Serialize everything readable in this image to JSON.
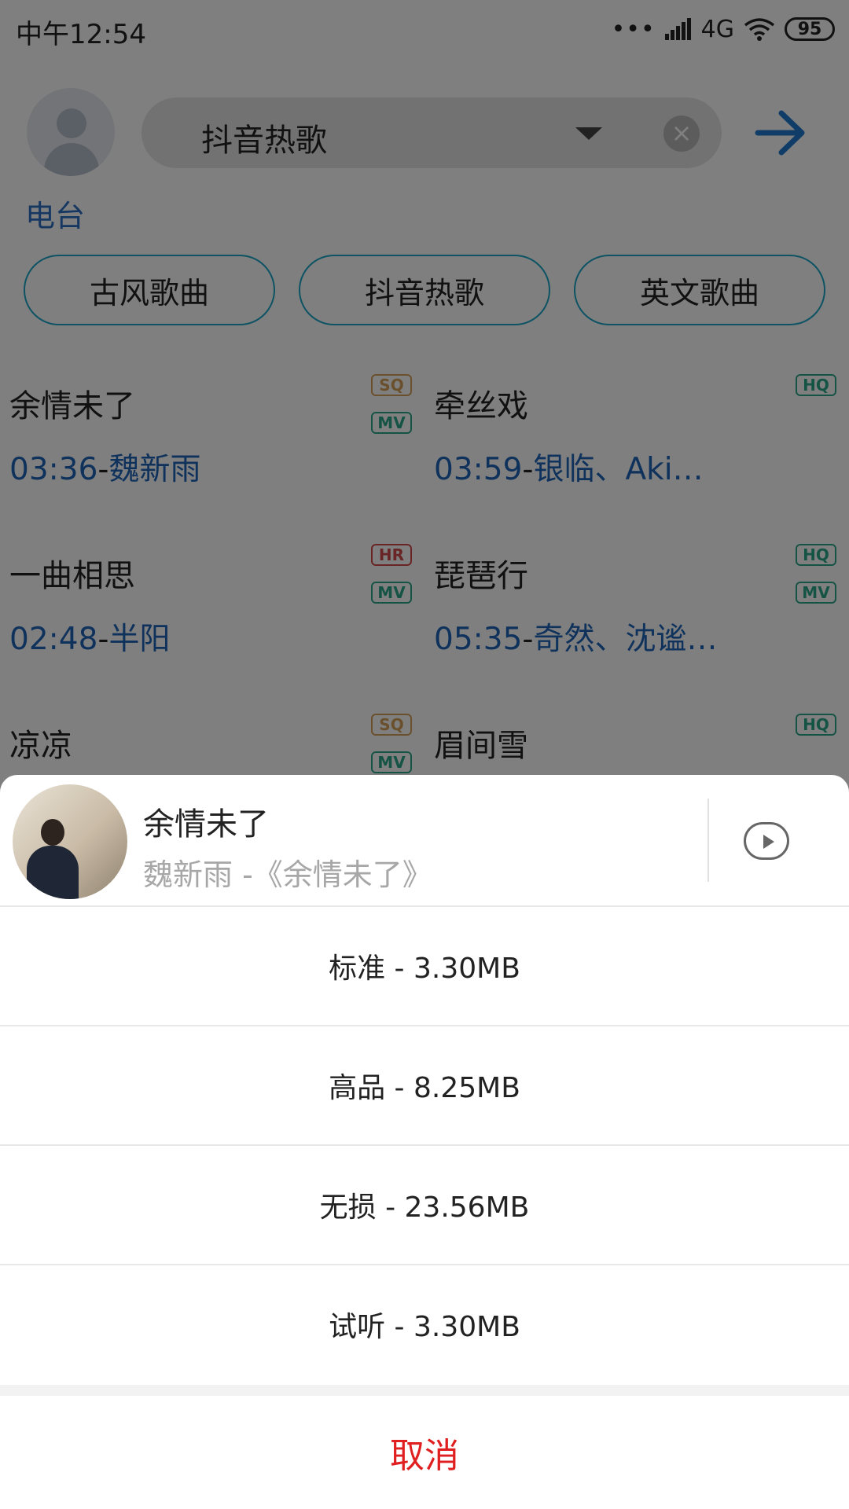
{
  "status_bar": {
    "time": "中午12:54",
    "dots": "•••",
    "network": "4G",
    "battery": "95"
  },
  "header": {
    "radio_label": "电台",
    "search": {
      "value": "抖音热歌"
    }
  },
  "tags": [
    "古风歌曲",
    "抖音热歌",
    "英文歌曲"
  ],
  "songs": [
    {
      "title": "余情未了",
      "duration": "03:36",
      "sep": "-",
      "artist": "魏新雨",
      "badges": [
        "SQ",
        "MV"
      ]
    },
    {
      "title": "牵丝戏",
      "duration": "03:59",
      "sep": "-",
      "artist": "银临、Aki…",
      "badges": [
        "HQ"
      ]
    },
    {
      "title": "一曲相思",
      "duration": "02:48",
      "sep": "-",
      "artist": "半阳",
      "badges": [
        "HR",
        "MV"
      ]
    },
    {
      "title": "琵琶行",
      "duration": "05:35",
      "sep": "-",
      "artist": "奇然、沈谧…",
      "badges": [
        "HQ",
        "MV"
      ]
    },
    {
      "title": "凉凉",
      "badges": [
        "SQ",
        "MV"
      ]
    },
    {
      "title": "眉间雪",
      "badges": [
        "HQ"
      ]
    }
  ],
  "sheet": {
    "song_title": "余情未了",
    "song_subtitle": "魏新雨 -《余情未了》",
    "options": [
      {
        "label": "标准 - 3.30MB"
      },
      {
        "label": "高品 - 8.25MB"
      },
      {
        "label": "无损 - 23.56MB"
      },
      {
        "label": "试听 - 3.30MB"
      }
    ],
    "cancel": "取消"
  },
  "colors": {
    "accent_blue": "#1f64b8",
    "tag_border": "#1aa7c9",
    "cancel_red": "#e02020",
    "badge_sq": "#d5a058",
    "badge_hr": "#d24a4a",
    "badge_hq": "#2ba88a"
  },
  "icons": [
    "avatar-icon",
    "dropdown-caret-icon",
    "clear-icon",
    "arrow-right-icon",
    "play-icon",
    "signal-icon",
    "wifi-icon",
    "battery-icon"
  ]
}
